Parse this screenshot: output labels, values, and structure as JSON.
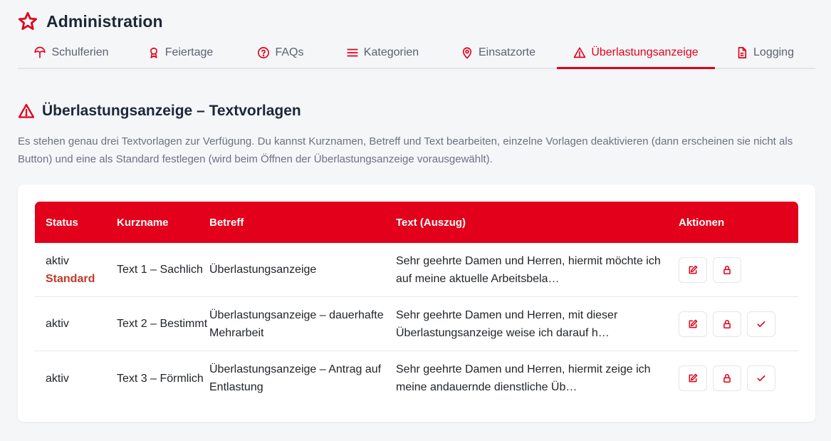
{
  "header": {
    "title": "Administration",
    "icon": "star-icon"
  },
  "tabs": [
    {
      "label": "Schulferien",
      "icon": "umbrella-icon",
      "active": false
    },
    {
      "label": "Feiertage",
      "icon": "award-icon",
      "active": false
    },
    {
      "label": "FAQs",
      "icon": "question-circle-icon",
      "active": false
    },
    {
      "label": "Kategorien",
      "icon": "list-icon",
      "active": false
    },
    {
      "label": "Einsatzorte",
      "icon": "map-pin-icon",
      "active": false
    },
    {
      "label": "Überlastungsanzeige",
      "icon": "warning-icon",
      "active": true
    },
    {
      "label": "Logging",
      "icon": "document-icon",
      "active": false
    }
  ],
  "section": {
    "title": "Überlastungsanzeige – Textvorlagen",
    "description": "Es stehen genau drei Textvorlagen zur Verfügung. Du kannst Kurznamen, Betreff und Text bearbeiten, einzelne Vorlagen deaktivieren (dann erscheinen sie nicht als Button) und eine als Standard festlegen (wird beim Öffnen der Überlastungsanzeige vorausgewählt)."
  },
  "table": {
    "columns": [
      "Status",
      "Kurzname",
      "Betreff",
      "Text (Auszug)",
      "Aktionen"
    ],
    "rows": [
      {
        "status": "aktiv",
        "badge": "Standard",
        "kurzname": "Text 1 – Sachlich",
        "betreff": "Überlastungsanzeige",
        "text": "Sehr geehrte Damen und Herren, hiermit möchte ich auf meine aktuelle Arbeitsbela…"
      },
      {
        "status": "aktiv",
        "badge": "",
        "kurzname": "Text 2 – Bestimmt",
        "betreff": "Überlastungsanzeige – dauerhafte Mehrarbeit",
        "text": "Sehr geehrte Damen und Herren, mit dieser Überlastungsanzeige weise ich darauf h…"
      },
      {
        "status": "aktiv",
        "badge": "",
        "kurzname": "Text 3 – Förmlich",
        "betreff": "Überlastungsanzeige – Antrag auf Entlastung",
        "text": "Sehr geehrte Damen und Herren, hiermit zeige ich meine andauernde dienstliche Üb…"
      }
    ]
  },
  "colors": {
    "accent": "#e2001a",
    "badge": "#c0392b"
  }
}
